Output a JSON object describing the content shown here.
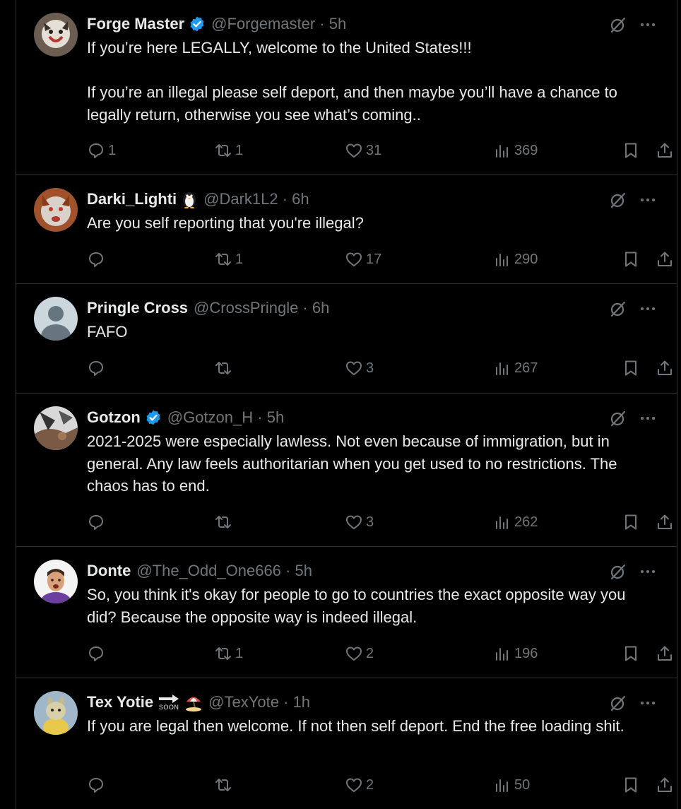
{
  "tweets": [
    {
      "name": "Forge Master",
      "verified": true,
      "handle": "@Forgemaster · 5h",
      "text": "If you’re here LEGALLY, welcome to the United States!!!\n\nIf you’re an illegal please self deport, and then maybe you’ll have a chance to legally return, otherwise you see what’s coming..",
      "replies": "1",
      "reposts": "1",
      "likes": "31",
      "views": "369"
    },
    {
      "name": "Darki_Lighti",
      "verified": false,
      "handle": "@Dark1L2 · 6h",
      "text": "Are you self reporting that you're illegal?",
      "replies": "",
      "reposts": "1",
      "likes": "17",
      "views": "290"
    },
    {
      "name": "Pringle Cross",
      "verified": false,
      "handle": "@CrossPringle · 6h",
      "text": "FAFO",
      "replies": "",
      "reposts": "",
      "likes": "3",
      "views": "267"
    },
    {
      "name": "Gotzon",
      "verified": true,
      "handle": "@Gotzon_H · 5h",
      "text": "2021-2025 were especially lawless. Not even because of immigration, but in general. Any law feels authoritarian when you get used to no restrictions. The chaos has to end.",
      "replies": "",
      "reposts": "",
      "likes": "3",
      "views": "262"
    },
    {
      "name": "Donte",
      "verified": false,
      "handle": "@The_Odd_One666 · 5h",
      "text": "So, you think it's okay for people to go to countries the exact opposite way you did? Because the opposite way is indeed illegal.",
      "replies": "",
      "reposts": "1",
      "likes": "2",
      "views": "196"
    },
    {
      "name": "Tex Yotie",
      "verified": false,
      "handle": "@TexYote · 1h",
      "soon_text": "SOON",
      "text": "If you are legal then welcome. If not then self deport. End the free loading shit.",
      "replies": "",
      "reposts": "",
      "likes": "2",
      "views": "50"
    }
  ],
  "colors": {
    "bg": "#000000",
    "text": "#e7e9ea",
    "muted": "#71767b",
    "divider": "#2f3336",
    "verified": "#1d9bf0"
  },
  "icons": [
    "verified-badge-icon",
    "grok-icon",
    "more-icon",
    "reply-icon",
    "repost-icon",
    "like-icon",
    "views-icon",
    "bookmark-icon",
    "share-icon",
    "penguin-emoji-icon",
    "soon-arrow-icon",
    "beach-umbrella-icon"
  ]
}
